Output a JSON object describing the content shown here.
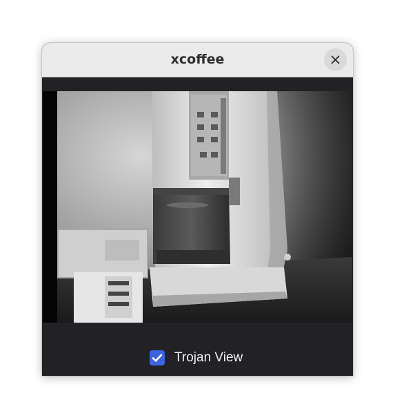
{
  "window": {
    "title": "xcoffee"
  },
  "controls": {
    "close_icon": "close-icon"
  },
  "trojan_view": {
    "label": "Trojan View",
    "checked": true,
    "accent_color": "#3d63e0"
  },
  "colors": {
    "titlebar_bg": "#ebebeb",
    "content_bg": "#222226",
    "label_text": "#f0f0f0"
  }
}
